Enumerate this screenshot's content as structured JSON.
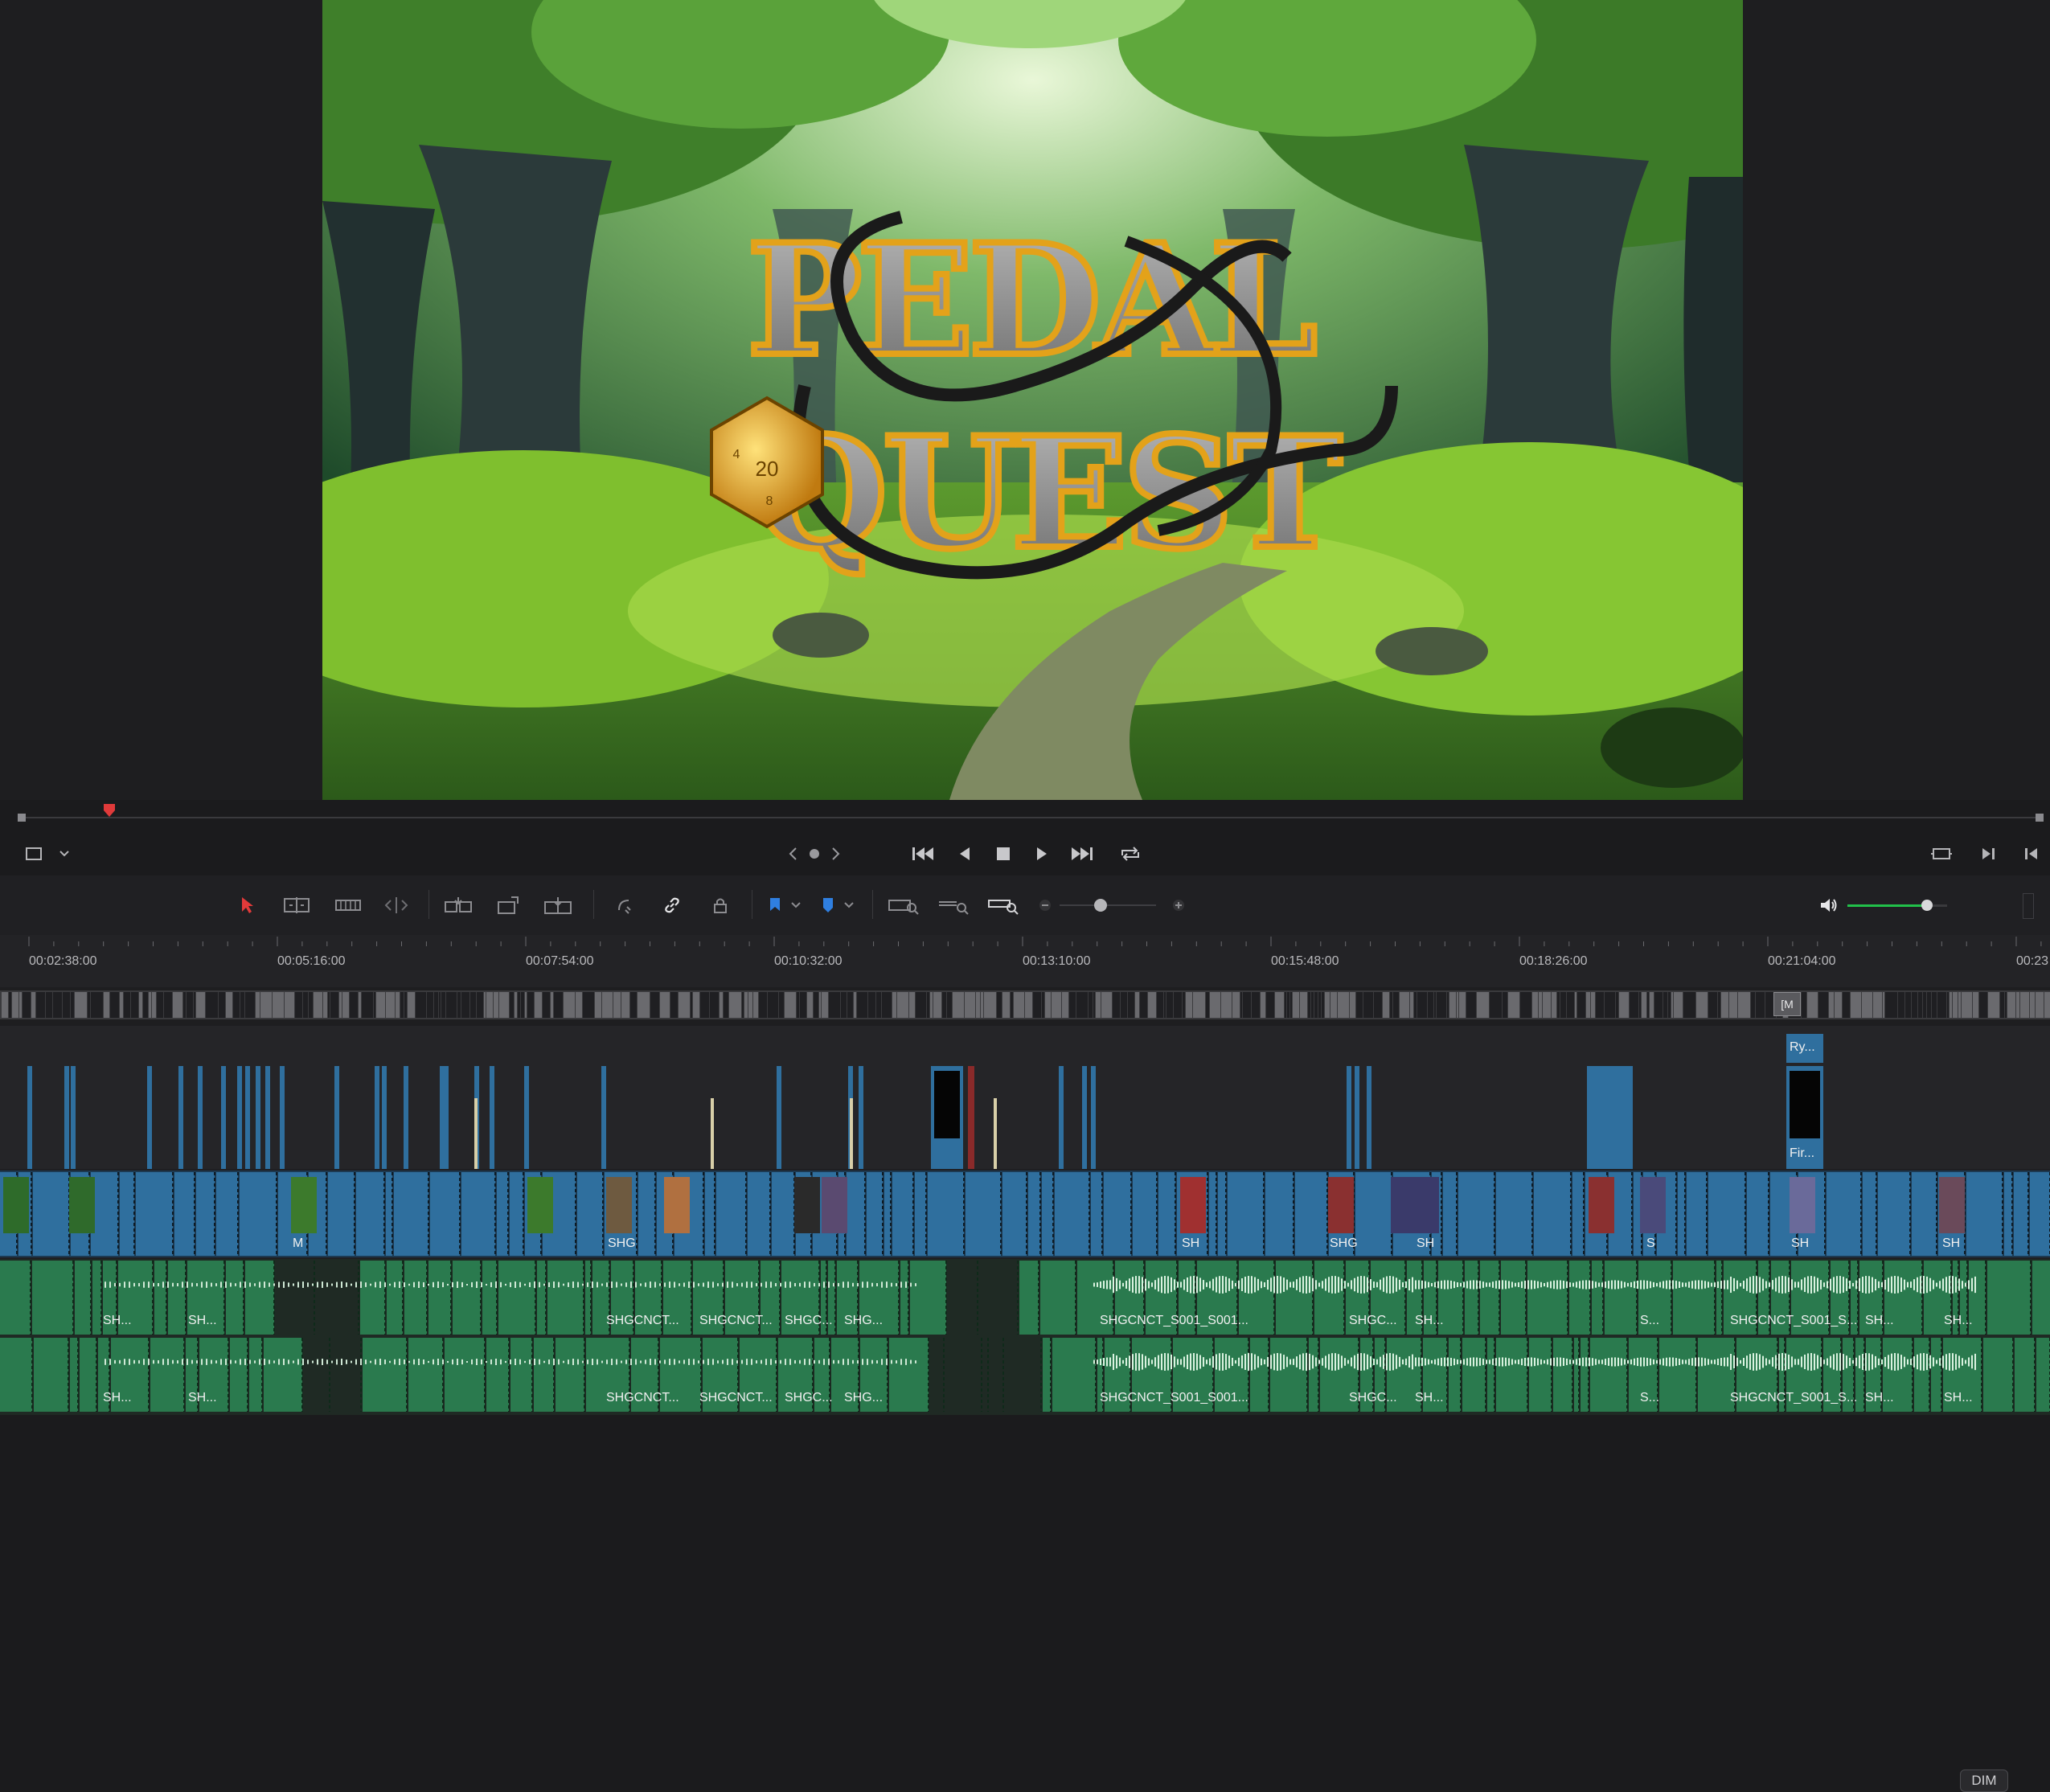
{
  "viewer": {
    "title_line1": "PEDAL",
    "title_line2": "QUEST",
    "die_value": "20",
    "die_side_left": "4",
    "die_side_right": "8"
  },
  "toolbar": {
    "dim_label": "DIM",
    "volume_level": 0.8
  },
  "ruler": {
    "timecodes": [
      "00:02:38:00",
      "00:05:16:00",
      "00:07:54:00",
      "00:10:32:00",
      "00:13:10:00",
      "00:15:48:00",
      "00:18:26:00",
      "00:21:04:00",
      "00:23"
    ]
  },
  "mini_track": {
    "marker_label": "[M"
  },
  "tracks": {
    "title_clips": [
      {
        "label": "Ry..."
      },
      {
        "label": "Fir..."
      }
    ],
    "video_clip_labels": [
      "M",
      "SHG",
      "SH",
      "SHG",
      "SH",
      "S",
      "SH",
      "SH"
    ],
    "audio1_labels": [
      "SH...",
      "SH...",
      "SHGCNCT...",
      "SHGCNCT...",
      "SHGC...",
      "SHG...",
      "SHGCNCT_S001_S001...",
      "SHGC...",
      "SH...",
      "S...",
      "SHGCNCT_S001_S...",
      "SH...",
      "SH..."
    ],
    "audio2_labels": [
      "SH...",
      "SH...",
      "SHGCNCT...",
      "SHGCNCT...",
      "SHGC...",
      "SHG...",
      "SHGCNCT_S001_S001...",
      "SHGC...",
      "SH...",
      "S...",
      "SHGCNCT_S001_S...",
      "SH...",
      "SH..."
    ]
  },
  "colors": {
    "clip_blue": "#2f6f9e",
    "clip_green": "#2a7a4e",
    "playhead_red": "#e03a3a",
    "volume_green": "#21c04a"
  }
}
